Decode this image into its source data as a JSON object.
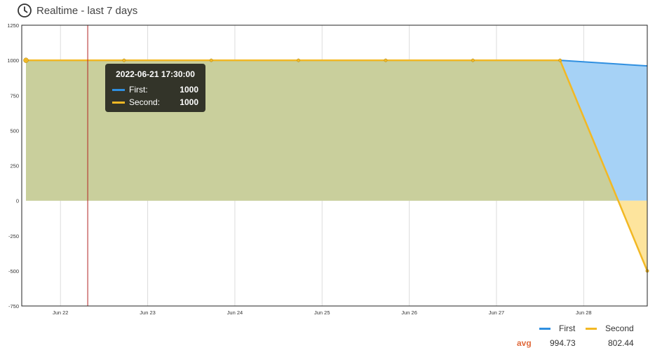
{
  "header": {
    "title": "Realtime - last 7 days",
    "icon": "clock-icon"
  },
  "chart_data": {
    "type": "area",
    "ylim": [
      -750,
      1250
    ],
    "y_ticks": [
      -750,
      -500,
      -250,
      0,
      250,
      500,
      750,
      1000,
      1250
    ],
    "x_range": [
      "2022-06-21 14:30",
      "2022-06-28 17:30"
    ],
    "x_ticks": [
      {
        "label": "Jun 22",
        "time": "2022-06-22 00:00"
      },
      {
        "label": "Jun 23",
        "time": "2022-06-23 00:00"
      },
      {
        "label": "Jun 24",
        "time": "2022-06-24 00:00"
      },
      {
        "label": "Jun 25",
        "time": "2022-06-25 00:00"
      },
      {
        "label": "Jun 26",
        "time": "2022-06-26 00:00"
      },
      {
        "label": "Jun 27",
        "time": "2022-06-27 00:00"
      },
      {
        "label": "Jun 28",
        "time": "2022-06-28 00:00"
      }
    ],
    "grid": true,
    "series": [
      {
        "name": "First",
        "color": "#2f8fe0",
        "fill": "#a6d2f6",
        "points": [
          [
            "2022-06-21 14:30",
            1000
          ],
          [
            "2022-06-22 17:30",
            1000
          ],
          [
            "2022-06-23 17:30",
            1000
          ],
          [
            "2022-06-24 17:30",
            1000
          ],
          [
            "2022-06-25 17:30",
            1000
          ],
          [
            "2022-06-26 17:30",
            1000
          ],
          [
            "2022-06-27 17:30",
            1000
          ],
          [
            "2022-06-28 17:30",
            960
          ]
        ]
      },
      {
        "name": "Second",
        "color": "#f2b824",
        "fill": "#fde49d",
        "points": [
          [
            "2022-06-21 14:30",
            1000
          ],
          [
            "2022-06-22 17:30",
            1000
          ],
          [
            "2022-06-23 17:30",
            1000
          ],
          [
            "2022-06-24 17:30",
            1000
          ],
          [
            "2022-06-25 17:30",
            1000
          ],
          [
            "2022-06-26 17:30",
            1000
          ],
          [
            "2022-06-27 17:30",
            1000
          ],
          [
            "2022-06-28 17:30",
            -500
          ]
        ]
      }
    ],
    "crosshair_time": "2022-06-22 07:30",
    "crosshair_color": "#b22222",
    "overlap_fill": "#c9cf9c"
  },
  "tooltip": {
    "title": "2022-06-21 17:30:00",
    "rows": [
      {
        "name": "First:",
        "value": "1000",
        "color": "#2f8fe0"
      },
      {
        "name": "Second:",
        "value": "1000",
        "color": "#f2b824"
      }
    ]
  },
  "legend": {
    "first": {
      "label": "First",
      "color": "#2f8fe0"
    },
    "second": {
      "label": "Second",
      "color": "#f2b824"
    }
  },
  "stats": {
    "avg_label": "avg",
    "first_avg": "994.73",
    "second_avg": "802.44"
  }
}
